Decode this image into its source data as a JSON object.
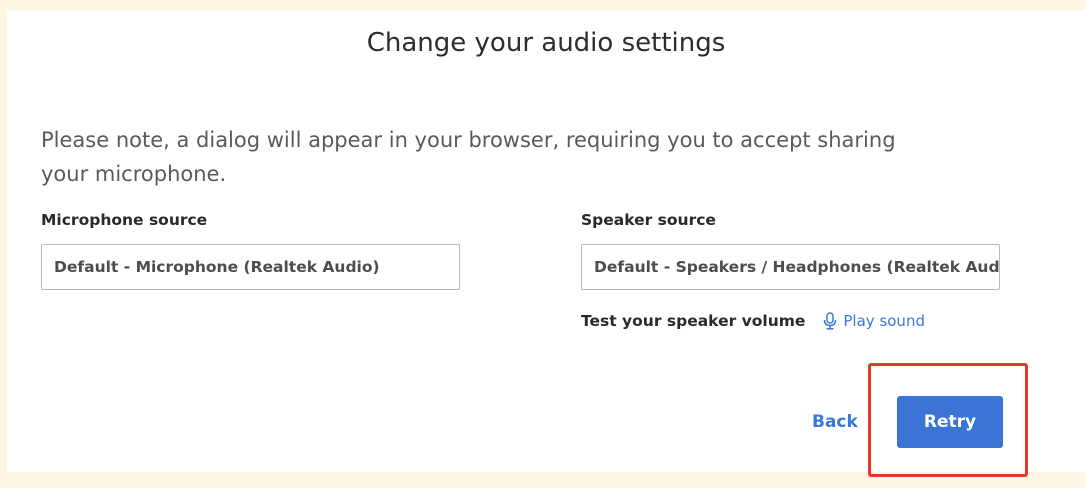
{
  "dialog": {
    "title": "Change your audio settings",
    "note": "Please note, a dialog will appear in your browser, requiring you to accept sharing your microphone."
  },
  "microphone": {
    "label": "Microphone source",
    "value": "Default - Microphone (Realtek Audio)"
  },
  "speaker": {
    "label": "Speaker source",
    "value": "Default - Speakers / Headphones (Realtek Audio)"
  },
  "test": {
    "label": "Test your speaker volume",
    "play_label": "Play sound",
    "play_icon": "microphone-icon"
  },
  "actions": {
    "back_label": "Back",
    "retry_label": "Retry"
  },
  "colors": {
    "background": "#fdf7e4",
    "accent": "#3a74d4",
    "highlight": "#e03a2c"
  }
}
